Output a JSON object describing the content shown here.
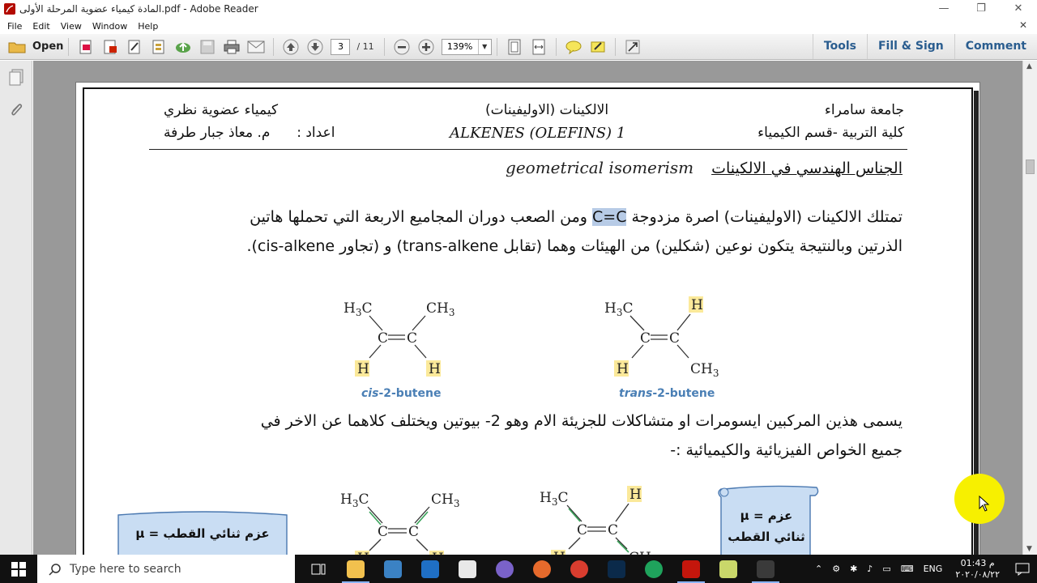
{
  "window": {
    "title": "المادة كيمياء عضوية المرحلة الأولى.pdf - Adobe Reader",
    "controls": [
      "—",
      "❐",
      "✕"
    ]
  },
  "menu": [
    "File",
    "Edit",
    "View",
    "Window",
    "Help"
  ],
  "toolbar": {
    "open_label": "Open",
    "page_current": "3",
    "page_total": "/ 11",
    "zoom": "139%",
    "right_links": [
      "Tools",
      "Fill & Sign",
      "Comment"
    ]
  },
  "document": {
    "header": {
      "left_top": "كيمياء عضوية نظري",
      "left_bottom_prefix": "اعداد :",
      "left_bottom_name": "م. معاذ جبار طرفة",
      "center_top": "الالكينات (الاوليفينات)",
      "center_bottom": "ALKENES (OLEFINS)  1",
      "right_top": "جامعة سامراء",
      "right_bottom": "كلية التربية -قسم الكيمياء"
    },
    "section_title_ar": "الجناس الهندسي في الالكينات",
    "section_title_en": "geometrical isomerism",
    "para1_line1_a": "تمتلك الالكينات (الاوليفينات) اصرة مزدوجة ",
    "para1_highlight": "C=C",
    "para1_line1_b": " ومن الصعب دوران المجاميع الاربعة التي تحملها هاتين",
    "para1_line2": "الذرتين وبالنتيجة يتكون نوعين (شكلين) من الهيئات وهما (تقابل trans-alkene) و (تجاور cis-alkene).",
    "cis_label_prefix": "cis",
    "cis_label_suffix": "-2-butene",
    "trans_label_prefix": "trans",
    "trans_label_suffix": "-2-butene",
    "para2_line1": "يسمى هذين المركبين ايسومرات او متشاكلات للجزيئة الام وهو 2- بيوتين ويختلف كلاهما عن الاخر في",
    "para2_line2": "جميع الخواص الفيزيائية والكيميائية :-",
    "dipole_left": "عزم ثنائي القطب = μ",
    "dipole_right_line1": "عزم = μ",
    "dipole_right_line2": "ثنائي القطب",
    "atoms": {
      "ch3": "CH",
      "h3c": "H",
      "h3c_c": "C",
      "sub3": "3",
      "h": "H",
      "c": "C"
    }
  },
  "taskbar": {
    "search_placeholder": "Type here to search",
    "lang": "ENG",
    "time": "01:43 م",
    "date": "٢٠٢٠/٠٨/٢٢"
  },
  "colors": {
    "highlight_h": "#fbe99a",
    "label_blue": "#4a7fb5",
    "scroll_fill": "#c9ddf3",
    "cursor_highlight": "#f7f000"
  }
}
